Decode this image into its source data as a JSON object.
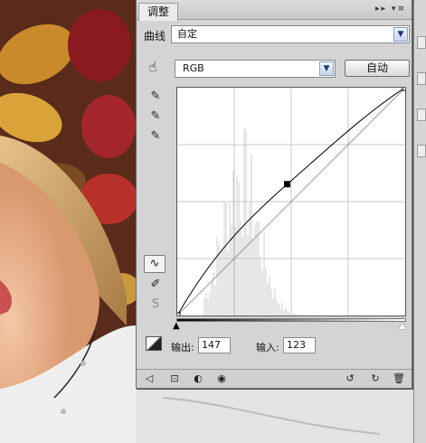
{
  "panel": {
    "tab_label": "调整",
    "menu_glyphs": "▸▸ ▾≡"
  },
  "preset": {
    "label": "曲线",
    "value": "自定"
  },
  "channel": {
    "value": "RGB",
    "auto_label": "自动"
  },
  "io": {
    "output_label": "输出:",
    "output_value": "147",
    "input_label": "输入:",
    "input_value": "123"
  },
  "icons": {
    "hand": "☝",
    "eyedropper_black": "✎",
    "eyedropper_gray": "✎",
    "eyedropper_white": "✎",
    "curve_point_tool": "∿",
    "pencil": "✐",
    "smooth": "S",
    "back": "◁",
    "clip": "⊡",
    "mask": "◐",
    "eye": "◉",
    "reset_prev": "↺",
    "reset": "↻",
    "trash": "🗑"
  },
  "curve": {
    "point_input": 123,
    "point_output": 147,
    "scale_max": 255,
    "control_points": [
      [
        0,
        0
      ],
      [
        123,
        147
      ],
      [
        255,
        255
      ]
    ]
  },
  "colors": {
    "panel_bg": "#d4d4d4",
    "curve": "#000000",
    "grid": "#c8c8c8",
    "histogram": "#cfcfcf"
  }
}
